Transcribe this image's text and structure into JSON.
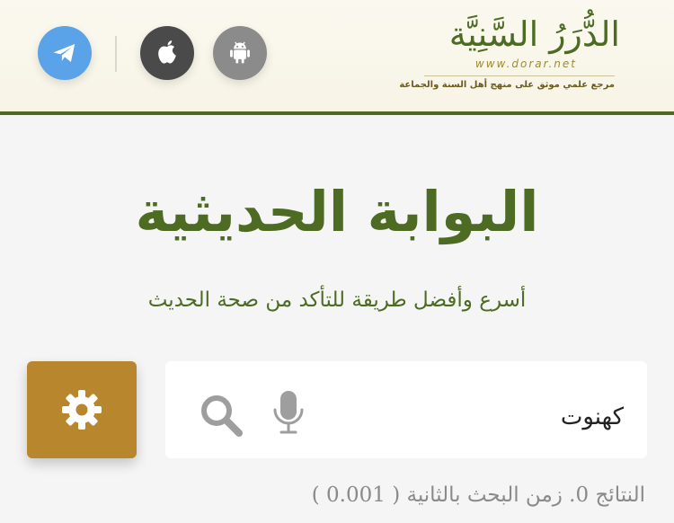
{
  "header": {
    "apps": {
      "telegram_icon": "telegram-icon",
      "apple_icon": "apple-icon",
      "android_icon": "android-icon"
    },
    "logo": {
      "title": "الدُّرَرُ السَّنِيَّة",
      "url": "www.dorar.net",
      "tagline": "مرجع علمي موثق على منهج أهل السنة والجماعة"
    }
  },
  "main": {
    "title": "البوابة الحديثية",
    "subtitle": "أسرع وأفضل طريقة للتأكد من صحة الحديث"
  },
  "search": {
    "value": "كهنوت",
    "mic_icon": "microphone-icon",
    "search_icon": "search-icon",
    "settings_icon": "gear-icon"
  },
  "results": {
    "text": "النتائج 0. زمن البحث بالثانية ( 0.001 )"
  },
  "colors": {
    "brand_green": "#4d6b23",
    "settings_gold": "#b8862c",
    "telegram_blue": "#5aa3e8",
    "apple_dark": "#4a4a4a",
    "android_gray": "#8b8b8b"
  }
}
